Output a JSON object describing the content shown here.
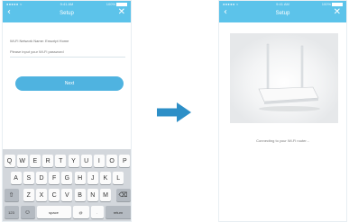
{
  "colors": {
    "accent": "#5cc3ea",
    "button": "#4fb3e0",
    "arrow": "#2d8fc7",
    "keyboard": "#d3d7dc"
  },
  "left": {
    "status": {
      "carrier": "●●●●● ≈",
      "time": "9:41 AM",
      "battery": "100%"
    },
    "nav": {
      "title": "Setup",
      "back_icon": "chevron-left-icon",
      "close_icon": "close-icon"
    },
    "field_label": "Wi-Fi Network Name: Enscript Home",
    "password_placeholder": "Please input your Wi-Fi password",
    "next_label": "Next"
  },
  "keyboard": {
    "row1": [
      "Q",
      "W",
      "E",
      "R",
      "T",
      "Y",
      "U",
      "I",
      "O",
      "P"
    ],
    "row2": [
      "A",
      "S",
      "D",
      "F",
      "G",
      "H",
      "J",
      "K",
      "L"
    ],
    "row3": [
      "Z",
      "X",
      "C",
      "V",
      "B",
      "N",
      "M"
    ],
    "shift": "⇧",
    "backspace": "⌫",
    "numbers": "123",
    "emoji": "☺",
    "space": "space",
    "at": "@",
    "dot": ".",
    "return": "return"
  },
  "right": {
    "status": {
      "carrier": "●●●●● ≈",
      "time": "9:41 AM",
      "battery": "100%"
    },
    "nav": {
      "title": "Setup",
      "back_icon": "chevron-left-icon",
      "close_icon": "close-icon"
    },
    "connecting_text": "Connecting to your Wi-Fi router..."
  }
}
